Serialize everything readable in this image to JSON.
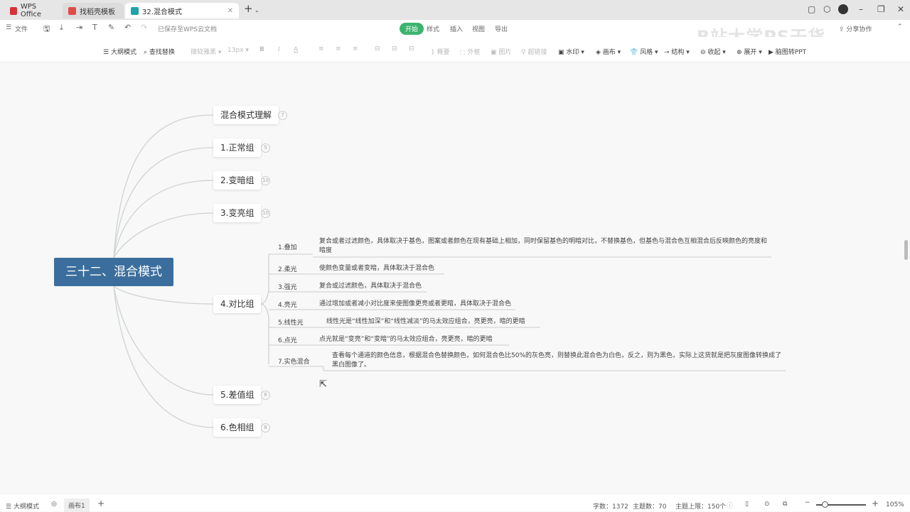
{
  "tabs": [
    {
      "label": "WPS Office",
      "color": "#d9303a"
    },
    {
      "label": "找稻壳模板",
      "color": "#e24b4b"
    },
    {
      "label": "32.混合模式",
      "color": "#1fa3a6",
      "active": true
    }
  ],
  "toolbar1": {
    "file": "文件",
    "saved": "已保存至WPS云文档",
    "menus": [
      "开始",
      "样式",
      "插入",
      "视图",
      "导出"
    ],
    "share": "分享协作"
  },
  "toolbar2": {
    "outline": "大纲模式",
    "find": "查找替换",
    "font": "微软雅黑",
    "size": "13px",
    "bold": "B",
    "italic": "I",
    "color": "A",
    "summary": "概要",
    "frame": "外框",
    "image": "图片",
    "link": "超链接",
    "watermark": "水印",
    "canvas": "画布",
    "style": "风格",
    "structure": "结构",
    "collapse": "收起",
    "expand": "展开",
    "toppt": "脑图转PPT"
  },
  "watermark": "B站大学PS干货",
  "mindmap": {
    "root": "三十二、混合模式",
    "branches": [
      {
        "label": "混合模式理解",
        "badge": "7"
      },
      {
        "label": "1.正常组",
        "badge": "5"
      },
      {
        "label": "2.变暗组",
        "badge": "10"
      },
      {
        "label": "3.变亮组",
        "badge": "10"
      },
      {
        "label": "4.对比组"
      },
      {
        "label": "5.差值组",
        "badge": "8"
      },
      {
        "label": "6.色相组",
        "badge": "8"
      }
    ],
    "contrast_items": [
      {
        "label": "1.叠加",
        "desc": "复合或者过滤颜色，具体取决于基色，图案或者颜色在现有基础上相加，同时保留基色的明暗对比，不替换基色，但基色与混合色互相混合后反映颜色的亮度和暗度"
      },
      {
        "label": "2.柔光",
        "desc": "使颜色变量或者变暗，具体取决于混合色"
      },
      {
        "label": "3.强光",
        "desc": "复合或过滤颜色，具体取决于混合色"
      },
      {
        "label": "4.亮光",
        "desc": "通过增加或者减小对比度来使图像更亮或者更暗，具体取决于混合色"
      },
      {
        "label": "5.线性光",
        "desc": "线性光是“线性加深”和“线性减淡”的马太效应组合，亮更亮，暗的更暗"
      },
      {
        "label": "6.点光",
        "desc": "点光就是“变亮”和“变暗”的马太效应组合，亮更亮，暗的更暗"
      },
      {
        "label": "7.实色混合",
        "desc": "查看每个通道的颜色信息，根据混合色替换颜色，如何混合色比50%的灰色亮，则替换此混合色为白色，反之，则为黑色，实际上这货就是把灰度图像转换成了黑白图像了。"
      }
    ]
  },
  "status": {
    "outline": "大纲模式",
    "sheet": "画布1",
    "word_count": "字数：1372",
    "topic_count": "主题数：70",
    "topic_limit": "主题上限：150个",
    "zoom": "105%"
  }
}
